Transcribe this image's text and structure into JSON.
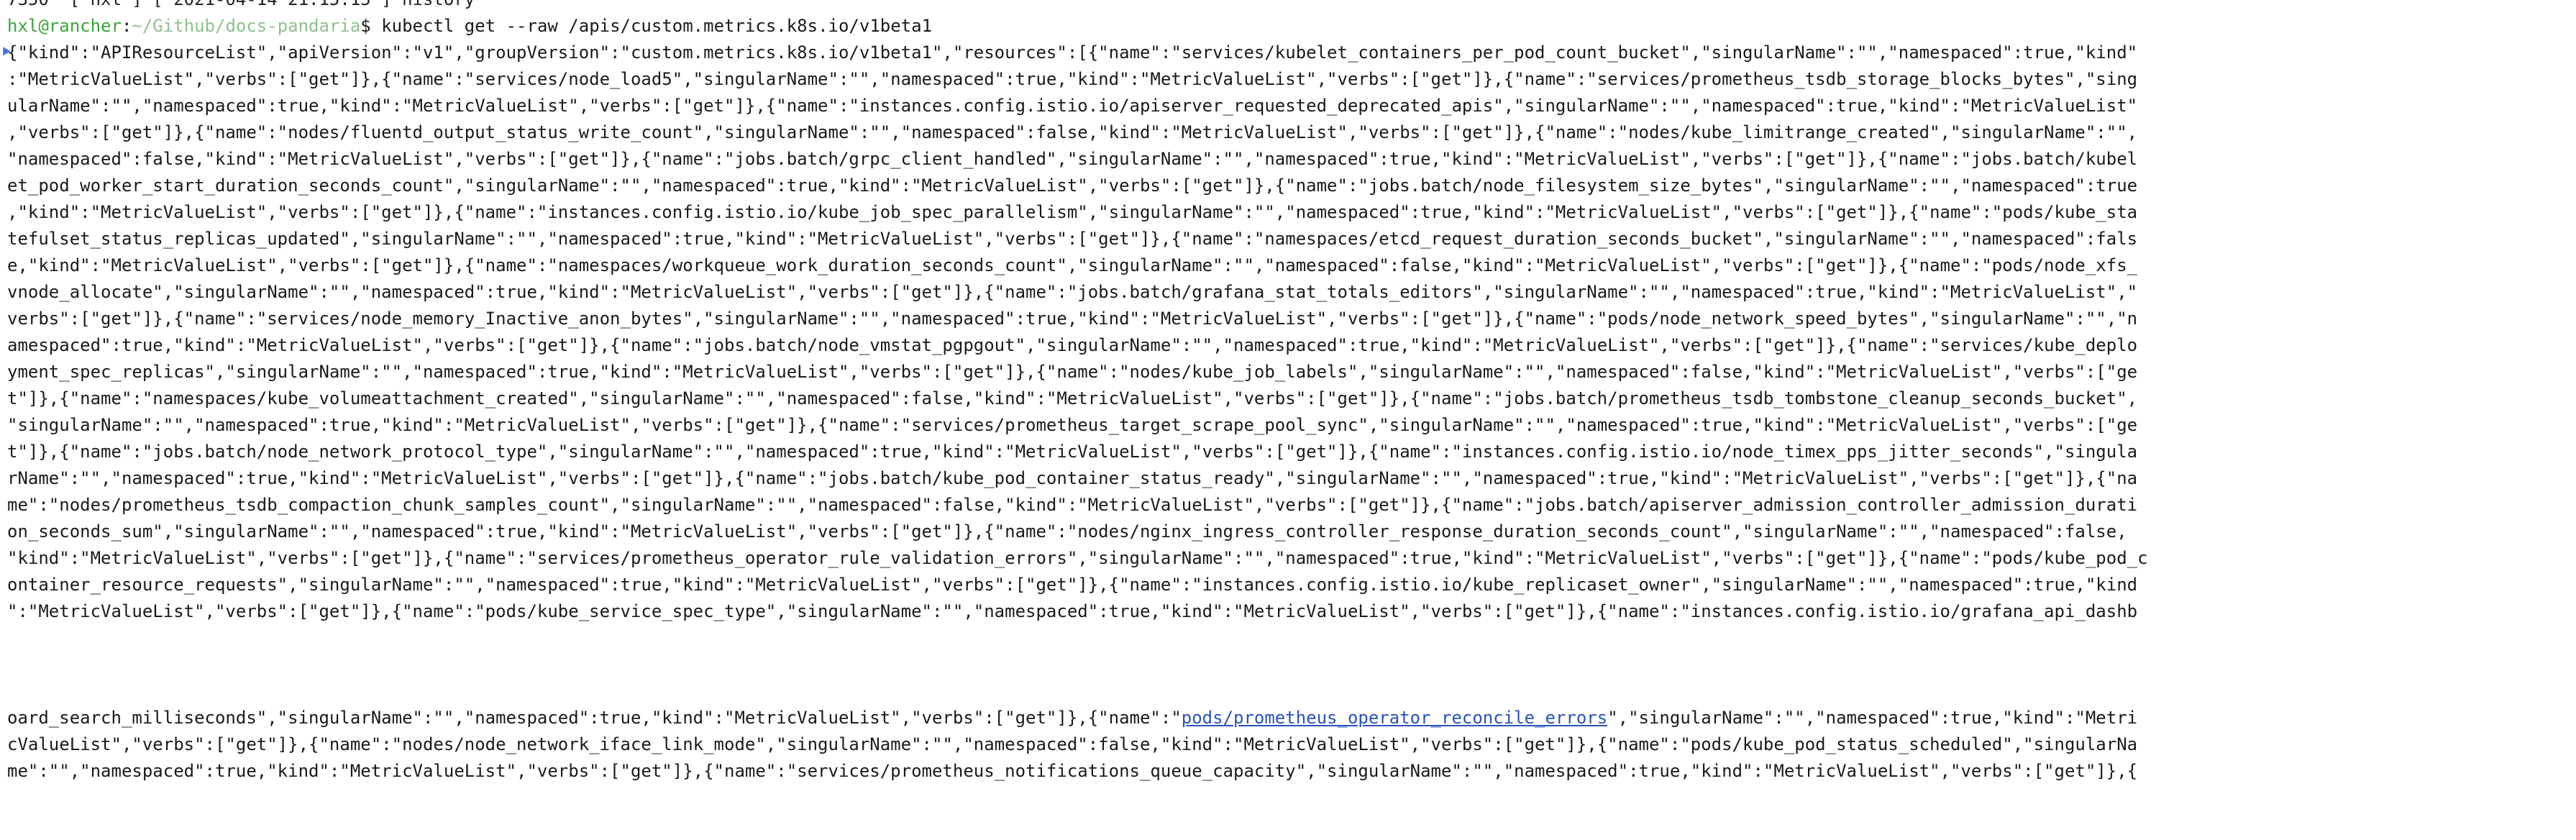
{
  "terminal": {
    "history_line": "7350  [ hxl ] [ 2021-04-14 21:15:15 ] history",
    "prompt": {
      "user_host": "hxl@rancher",
      "separator": ":",
      "path": "~/Github/docs-pandaria",
      "symbol": "$",
      "command": "kubectl get --raw /apis/custom.metrics.k8s.io/v1beta1"
    },
    "output_marker_icon": "mark-icon",
    "output_lines": [
      "{\"kind\":\"APIResourceList\",\"apiVersion\":\"v1\",\"groupVersion\":\"custom.metrics.k8s.io/v1beta1\",\"resources\":[{\"name\":\"services/kubelet_containers_per_pod_count_bucket\",\"singularName\":\"\",\"namespaced\":true,\"kind\"",
      ":\"MetricValueList\",\"verbs\":[\"get\"]},{\"name\":\"services/node_load5\",\"singularName\":\"\",\"namespaced\":true,\"kind\":\"MetricValueList\",\"verbs\":[\"get\"]},{\"name\":\"services/prometheus_tsdb_storage_blocks_bytes\",\"sing",
      "ularName\":\"\",\"namespaced\":true,\"kind\":\"MetricValueList\",\"verbs\":[\"get\"]},{\"name\":\"instances.config.istio.io/apiserver_requested_deprecated_apis\",\"singularName\":\"\",\"namespaced\":true,\"kind\":\"MetricValueList\"",
      ",\"verbs\":[\"get\"]},{\"name\":\"nodes/fluentd_output_status_write_count\",\"singularName\":\"\",\"namespaced\":false,\"kind\":\"MetricValueList\",\"verbs\":[\"get\"]},{\"name\":\"nodes/kube_limitrange_created\",\"singularName\":\"\",",
      "\"namespaced\":false,\"kind\":\"MetricValueList\",\"verbs\":[\"get\"]},{\"name\":\"jobs.batch/grpc_client_handled\",\"singularName\":\"\",\"namespaced\":true,\"kind\":\"MetricValueList\",\"verbs\":[\"get\"]},{\"name\":\"jobs.batch/kubel",
      "et_pod_worker_start_duration_seconds_count\",\"singularName\":\"\",\"namespaced\":true,\"kind\":\"MetricValueList\",\"verbs\":[\"get\"]},{\"name\":\"jobs.batch/node_filesystem_size_bytes\",\"singularName\":\"\",\"namespaced\":true",
      ",\"kind\":\"MetricValueList\",\"verbs\":[\"get\"]},{\"name\":\"instances.config.istio.io/kube_job_spec_parallelism\",\"singularName\":\"\",\"namespaced\":true,\"kind\":\"MetricValueList\",\"verbs\":[\"get\"]},{\"name\":\"pods/kube_sta",
      "tefulset_status_replicas_updated\",\"singularName\":\"\",\"namespaced\":true,\"kind\":\"MetricValueList\",\"verbs\":[\"get\"]},{\"name\":\"namespaces/etcd_request_duration_seconds_bucket\",\"singularName\":\"\",\"namespaced\":fals",
      "e,\"kind\":\"MetricValueList\",\"verbs\":[\"get\"]},{\"name\":\"namespaces/workqueue_work_duration_seconds_count\",\"singularName\":\"\",\"namespaced\":false,\"kind\":\"MetricValueList\",\"verbs\":[\"get\"]},{\"name\":\"pods/node_xfs_",
      "vnode_allocate\",\"singularName\":\"\",\"namespaced\":true,\"kind\":\"MetricValueList\",\"verbs\":[\"get\"]},{\"name\":\"jobs.batch/grafana_stat_totals_editors\",\"singularName\":\"\",\"namespaced\":true,\"kind\":\"MetricValueList\",\"",
      "verbs\":[\"get\"]},{\"name\":\"services/node_memory_Inactive_anon_bytes\",\"singularName\":\"\",\"namespaced\":true,\"kind\":\"MetricValueList\",\"verbs\":[\"get\"]},{\"name\":\"pods/node_network_speed_bytes\",\"singularName\":\"\",\"n",
      "amespaced\":true,\"kind\":\"MetricValueList\",\"verbs\":[\"get\"]},{\"name\":\"jobs.batch/node_vmstat_pgpgout\",\"singularName\":\"\",\"namespaced\":true,\"kind\":\"MetricValueList\",\"verbs\":[\"get\"]},{\"name\":\"services/kube_deplo",
      "yment_spec_replicas\",\"singularName\":\"\",\"namespaced\":true,\"kind\":\"MetricValueList\",\"verbs\":[\"get\"]},{\"name\":\"nodes/kube_job_labels\",\"singularName\":\"\",\"namespaced\":false,\"kind\":\"MetricValueList\",\"verbs\":[\"ge",
      "t\"]},{\"name\":\"namespaces/kube_volumeattachment_created\",\"singularName\":\"\",\"namespaced\":false,\"kind\":\"MetricValueList\",\"verbs\":[\"get\"]},{\"name\":\"jobs.batch/prometheus_tsdb_tombstone_cleanup_seconds_bucket\",",
      "\"singularName\":\"\",\"namespaced\":true,\"kind\":\"MetricValueList\",\"verbs\":[\"get\"]},{\"name\":\"services/prometheus_target_scrape_pool_sync\",\"singularName\":\"\",\"namespaced\":true,\"kind\":\"MetricValueList\",\"verbs\":[\"ge",
      "t\"]},{\"name\":\"jobs.batch/node_network_protocol_type\",\"singularName\":\"\",\"namespaced\":true,\"kind\":\"MetricValueList\",\"verbs\":[\"get\"]},{\"name\":\"instances.config.istio.io/node_timex_pps_jitter_seconds\",\"singula",
      "rName\":\"\",\"namespaced\":true,\"kind\":\"MetricValueList\",\"verbs\":[\"get\"]},{\"name\":\"jobs.batch/kube_pod_container_status_ready\",\"singularName\":\"\",\"namespaced\":true,\"kind\":\"MetricValueList\",\"verbs\":[\"get\"]},{\"na",
      "me\":\"nodes/prometheus_tsdb_compaction_chunk_samples_count\",\"singularName\":\"\",\"namespaced\":false,\"kind\":\"MetricValueList\",\"verbs\":[\"get\"]},{\"name\":\"jobs.batch/apiserver_admission_controller_admission_durati",
      "on_seconds_sum\",\"singularName\":\"\",\"namespaced\":true,\"kind\":\"MetricValueList\",\"verbs\":[\"get\"]},{\"name\":\"nodes/nginx_ingress_controller_response_duration_seconds_count\",\"singularName\":\"\",\"namespaced\":false,",
      "\"kind\":\"MetricValueList\",\"verbs\":[\"get\"]},{\"name\":\"services/prometheus_operator_rule_validation_errors\",\"singularName\":\"\",\"namespaced\":true,\"kind\":\"MetricValueList\",\"verbs\":[\"get\"]},{\"name\":\"pods/kube_pod_c",
      "ontainer_resource_requests\",\"singularName\":\"\",\"namespaced\":true,\"kind\":\"MetricValueList\",\"verbs\":[\"get\"]},{\"name\":\"instances.config.istio.io/kube_replicaset_owner\",\"singularName\":\"\",\"namespaced\":true,\"kind",
      "\":\"MetricValueList\",\"verbs\":[\"get\"]},{\"name\":\"pods/kube_service_spec_type\",\"singularName\":\"\",\"namespaced\":true,\"kind\":\"MetricValueList\",\"verbs\":[\"get\"]},{\"name\":\"instances.config.istio.io/grafana_api_dashb"
    ],
    "link_line": {
      "before": "oard_search_milliseconds\",\"singularName\":\"\",\"namespaced\":true,\"kind\":\"MetricValueList\",\"verbs\":[\"get\"]},{\"name\":\"",
      "link": "pods/prometheus_operator_reconcile_errors",
      "after": "\",\"singularName\":\"\",\"namespaced\":true,\"kind\":\"Metri"
    },
    "tail_lines": [
      "cValueList\",\"verbs\":[\"get\"]},{\"name\":\"nodes/node_network_iface_link_mode\",\"singularName\":\"\",\"namespaced\":false,\"kind\":\"MetricValueList\",\"verbs\":[\"get\"]},{\"name\":\"pods/kube_pod_status_scheduled\",\"singularNa",
      "me\":\"\",\"namespaced\":true,\"kind\":\"MetricValueList\",\"verbs\":[\"get\"]},{\"name\":\"services/prometheus_notifications_queue_capacity\",\"singularName\":\"\",\"namespaced\":true,\"kind\":\"MetricValueList\",\"verbs\":[\"get\"]},{"
    ],
    "colors": {
      "background": "#ffffff",
      "text": "#1a1a1a",
      "prompt_user": "#3aa33a",
      "prompt_path": "#8fc08f",
      "link": "#2a52be"
    }
  }
}
